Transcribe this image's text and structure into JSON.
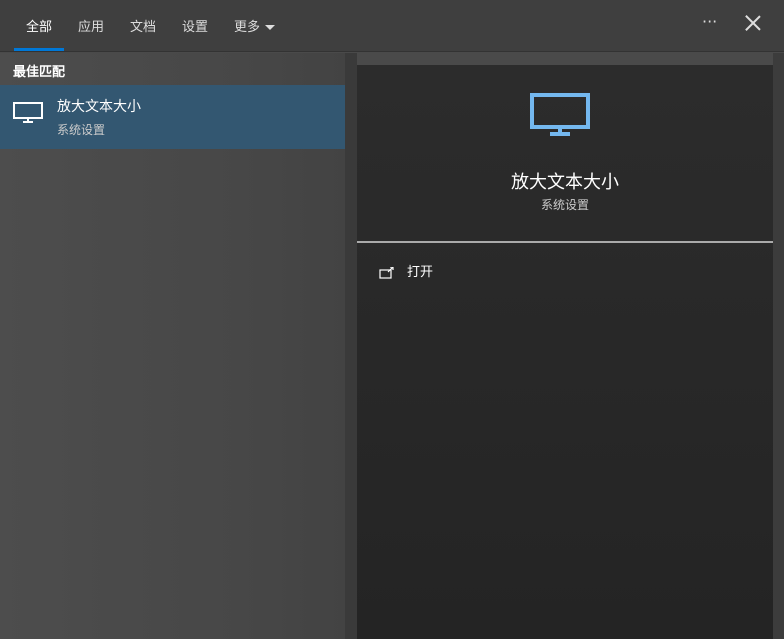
{
  "tabs": [
    {
      "label": "全部"
    },
    {
      "label": "应用"
    },
    {
      "label": "文档"
    },
    {
      "label": "设置"
    },
    {
      "label": "更多"
    }
  ],
  "best_match": {
    "heading": "最佳匹配",
    "title": "放大文本大小",
    "subtitle": "系统设置"
  },
  "detail": {
    "title": "放大文本大小",
    "subtitle": "系统设置",
    "actions": [
      {
        "label": "打开",
        "icon": "open-external-icon"
      }
    ]
  },
  "more_label": "···",
  "colors": {
    "accent": "#0078d7",
    "selection": "#335771",
    "icon_blue": "#74b8ef"
  }
}
